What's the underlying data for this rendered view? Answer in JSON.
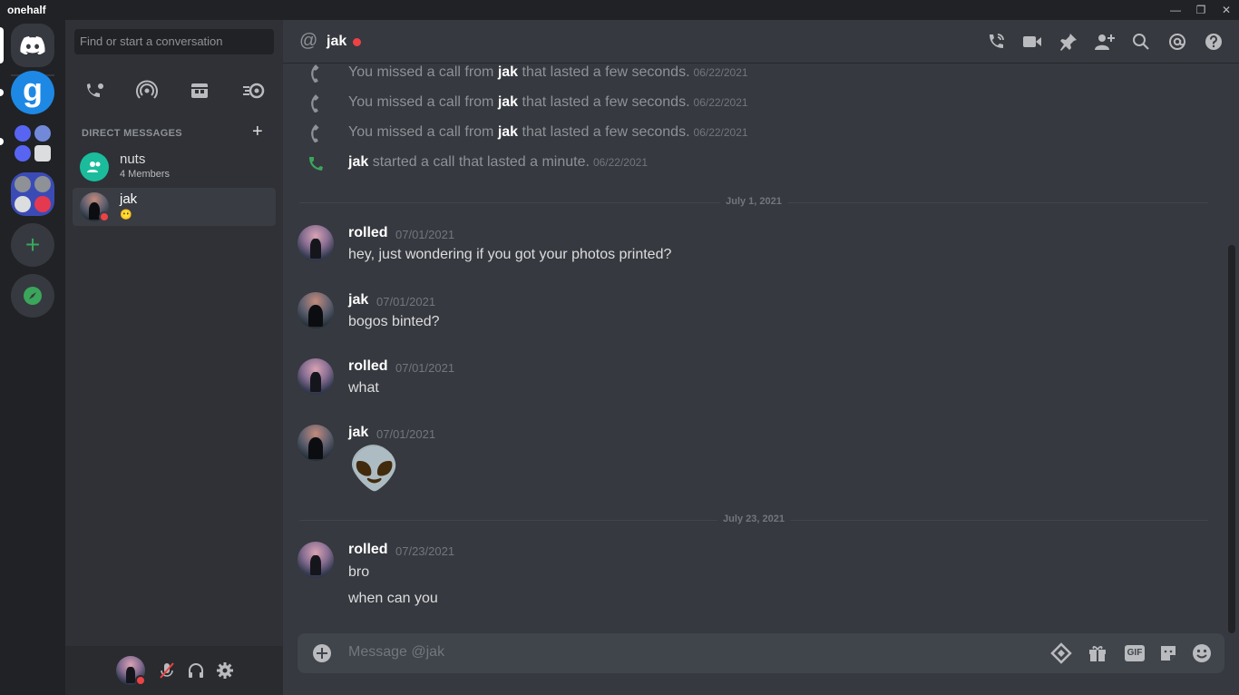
{
  "window": {
    "app_name": "onehalf",
    "minimize": "—",
    "restore": "❐",
    "close": "✕"
  },
  "guilds": {
    "home_icon": "discord-logo-icon",
    "add_server": "+",
    "explore": "compass-icon",
    "g_letter": "g"
  },
  "sidebar": {
    "search_placeholder": "Find or start a conversation",
    "dm_header": "DIRECT MESSAGES",
    "dm_add": "+",
    "dms": [
      {
        "name": "nuts",
        "sub": "4 Members"
      },
      {
        "name": "jak",
        "sub": "😶"
      }
    ]
  },
  "header": {
    "at_symbol": "@",
    "title": "jak"
  },
  "system_messages": [
    {
      "pre": "You missed a call from ",
      "name": "jak",
      "post": " that lasted a few seconds.",
      "time": "06/22/2021"
    },
    {
      "pre": "You missed a call from ",
      "name": "jak",
      "post": " that lasted a few seconds.",
      "time": "06/22/2021"
    },
    {
      "pre": "You missed a call from ",
      "name": "jak",
      "post": " that lasted a few seconds.",
      "time": "06/22/2021"
    },
    {
      "pre": "",
      "name": "jak",
      "post": " started a call that lasted a minute.",
      "time": "06/22/2021"
    }
  ],
  "dividers": [
    "July 1, 2021",
    "July 23, 2021"
  ],
  "messages": [
    {
      "author": "rolled",
      "time": "07/01/2021",
      "lines": [
        "hey, just wondering if you got your photos printed?"
      ]
    },
    {
      "author": "jak",
      "time": "07/01/2021",
      "lines": [
        "bogos binted?"
      ]
    },
    {
      "author": "rolled",
      "time": "07/01/2021",
      "lines": [
        "what"
      ]
    },
    {
      "author": "jak",
      "time": "07/01/2021",
      "lines": [
        "👽"
      ]
    },
    {
      "author": "rolled",
      "time": "07/23/2021",
      "lines": [
        "bro",
        "when can you"
      ]
    }
  ],
  "composer": {
    "placeholder": "Message @jak",
    "gif_label": "GIF"
  }
}
